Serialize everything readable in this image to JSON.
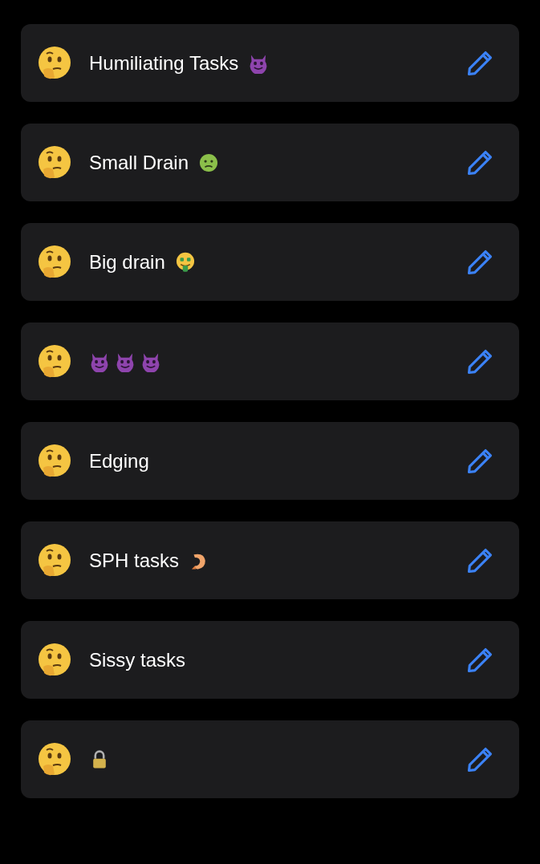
{
  "items": [
    {
      "label": "Humiliating Tasks",
      "trailing_icons": [
        {
          "kind": "devil"
        }
      ]
    },
    {
      "label": "Small Drain",
      "trailing_icons": [
        {
          "kind": "sick"
        }
      ]
    },
    {
      "label": "Big drain",
      "trailing_icons": [
        {
          "kind": "money"
        }
      ]
    },
    {
      "trailing_icons": [
        {
          "kind": "devil"
        },
        {
          "kind": "devil"
        },
        {
          "kind": "devil"
        }
      ]
    },
    {
      "label": "Edging"
    },
    {
      "label": "SPH tasks",
      "trailing_icons": [
        {
          "kind": "shrimp"
        }
      ]
    },
    {
      "label": "Sissy tasks"
    },
    {
      "trailing_icons": [
        {
          "kind": "lock"
        }
      ]
    }
  ]
}
